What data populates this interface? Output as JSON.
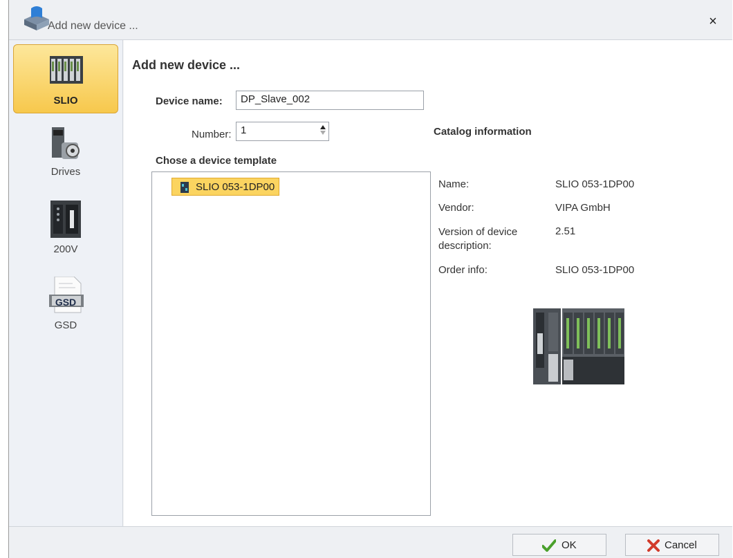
{
  "window": {
    "title": "Add new device ...",
    "close_label": "×"
  },
  "sidebar": {
    "items": [
      {
        "label": "SLIO",
        "icon": "slio-module-icon",
        "selected": true
      },
      {
        "label": "Drives",
        "icon": "drive-icon",
        "selected": false
      },
      {
        "label": "200V",
        "icon": "plc-200v-icon",
        "selected": false
      },
      {
        "label": "GSD",
        "icon": "gsd-file-icon",
        "selected": false
      }
    ]
  },
  "main": {
    "heading": "Add new device ...",
    "device_name_label": "Device name:",
    "device_name_value": "DP_Slave_002",
    "number_label": "Number:",
    "number_value": "1",
    "template_heading": "Chose a device template",
    "tree_items": [
      {
        "label": "SLIO 053-1DP00",
        "icon": "slio-small-icon",
        "selected": true
      }
    ]
  },
  "catalog": {
    "heading": "Catalog information",
    "rows": [
      {
        "key": "Name:",
        "value": "SLIO 053-1DP00"
      },
      {
        "key": "Vendor:",
        "value": "VIPA GmbH"
      },
      {
        "key": "Version of device description:",
        "value": "2.51"
      },
      {
        "key": "Order info:",
        "value": "SLIO 053-1DP00"
      }
    ],
    "image": "slio-module-image"
  },
  "footer": {
    "ok_label": "OK",
    "cancel_label": "Cancel"
  },
  "colors": {
    "selected_fill": "#fbd460",
    "ok_check": "#4aa02c",
    "cancel_x": "#d23b2b"
  }
}
